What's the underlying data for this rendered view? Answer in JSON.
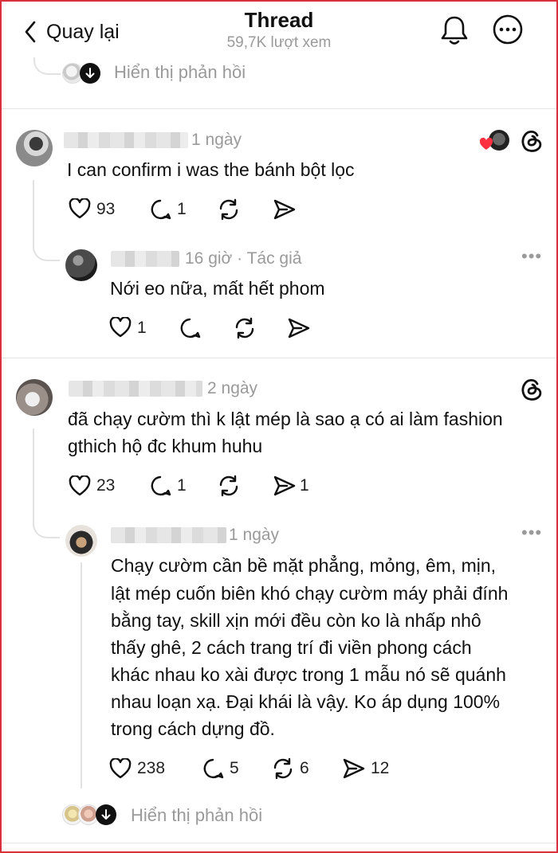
{
  "header": {
    "back_label": "Quay lại",
    "title": "Thread",
    "views": "59,7K lượt xem",
    "icons": [
      "bell-icon",
      "more-icon"
    ]
  },
  "top_show_replies": "Hiển thị phản hồi",
  "comments": [
    {
      "time": "1 ngày",
      "text": "I can confirm i was the bánh bột lọc",
      "likes": "93",
      "replies": "1",
      "reply": {
        "time": "16 giờ · Tác giả",
        "text": "Nới eo nữa, mất hết phom",
        "likes": "1"
      }
    },
    {
      "time": "2 ngày",
      "text_lines": [
        "đã chạy cườm thì k lật mép là sao ạ có ai làm fashion",
        "gthich hộ đc khum huhu"
      ],
      "likes": "23",
      "replies": "1",
      "shares": "1",
      "reply": {
        "time": "1 ngày",
        "text_lines": [
          "Chạy cườm cần bề mặt phẳng, mỏng, êm, mịn,",
          "lật mép cuốn biên khó chạy cườm máy phải đính",
          "bằng tay, skill xịn mới đều còn ko là nhấp nhô",
          "thấy ghê, 2 cách trang trí đi viền phong cách",
          "khác nhau ko xài được trong 1 mẫu nó sẽ quánh",
          "nhau loạn xạ. Đại khái là vậy. Ko áp dụng 100%",
          "trong cách dựng đồ."
        ],
        "likes": "238",
        "replies": "5",
        "reposts": "6",
        "shares": "12"
      }
    }
  ],
  "bottom_show_replies": "Hiển thị phản hồi",
  "colors": {
    "border": "#d9303c",
    "heart": "#ff3040",
    "muted": "#999999"
  }
}
